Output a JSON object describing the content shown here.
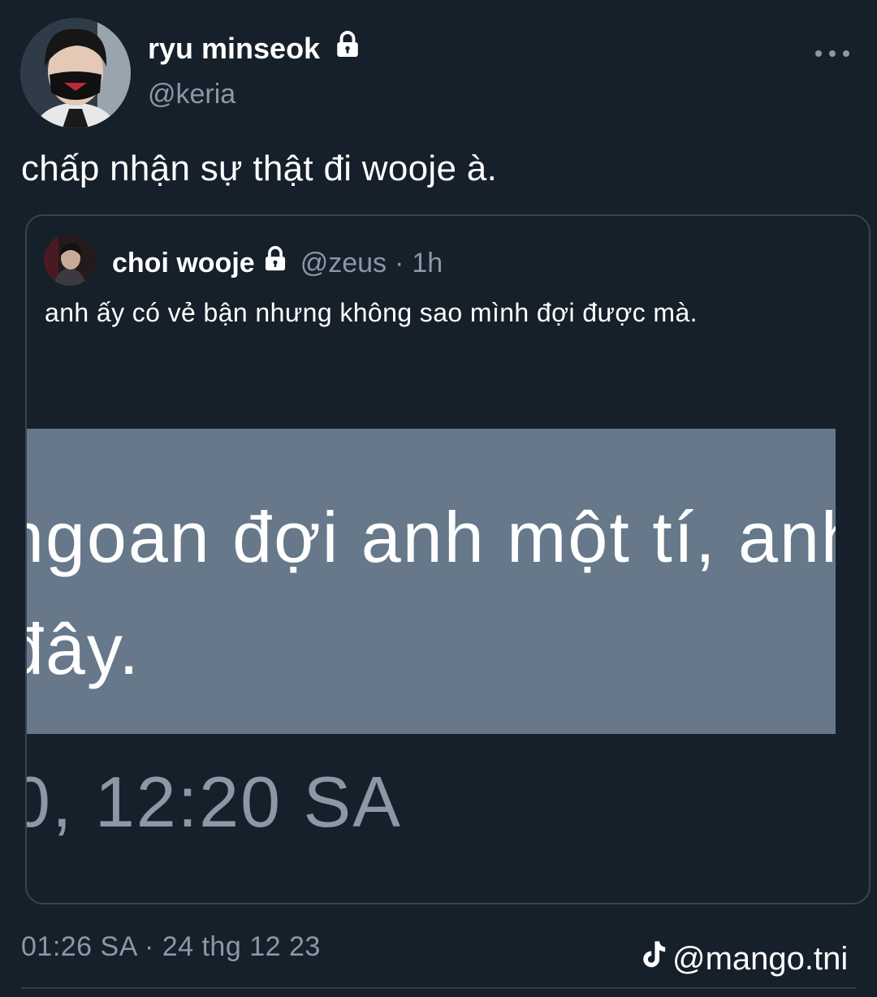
{
  "author": {
    "display_name": "ryu minseok",
    "handle": "@keria",
    "verified_icon": "lock-icon",
    "avatar": "avatar"
  },
  "tweet": {
    "text": "chấp nhận sự thật đi wooje à."
  },
  "quoted_tweet": {
    "display_name": "choi wooje",
    "handle": "@zeus",
    "separator": "·",
    "time": "1h",
    "text": "anh ấy có vẻ bận nhưng không sao mình đợi được mà.",
    "image": {
      "line1": "ngoan đợi anh một tí, anh",
      "line2": "đây.",
      "time_text": "0, 12:20 SA"
    }
  },
  "footer": {
    "timestamp": "01:26 SA · 24 thg 12 23",
    "watermark": "@mango.tni"
  },
  "colors": {
    "background": "#15202b",
    "secondary_text": "#8b98a5",
    "border": "#38444d",
    "image_background": "#66788a"
  }
}
